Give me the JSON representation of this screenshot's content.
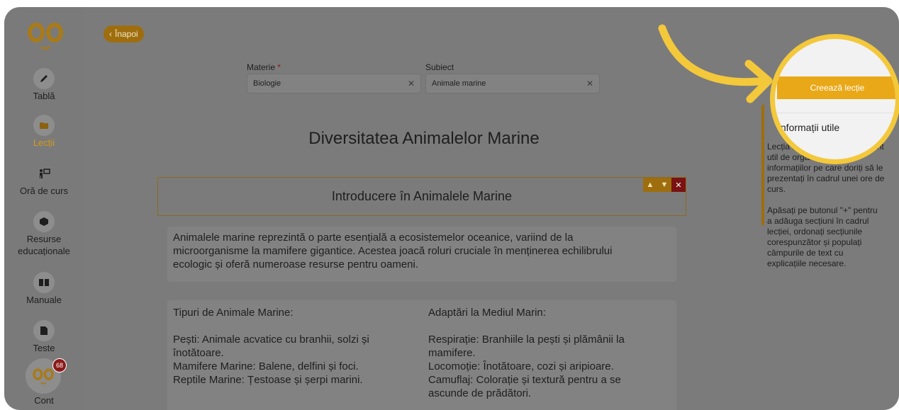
{
  "sidebar": {
    "items": [
      {
        "label": "Tablă",
        "icon": "pencil-icon"
      },
      {
        "label": "Lecții",
        "icon": "folder-icon"
      },
      {
        "label": "Oră de curs",
        "icon": "teacher-board-icon"
      },
      {
        "label": "Resurse",
        "label2": "educaționale",
        "icon": "cube-icon"
      },
      {
        "label": "Manuale",
        "icon": "book-icon"
      },
      {
        "label": "Teste",
        "icon": "document-icon"
      },
      {
        "label": "Cont",
        "icon": "avatar-icon"
      }
    ],
    "notification_count": "68"
  },
  "header": {
    "back_label": "Înapoi"
  },
  "form": {
    "materie_label": "Materie",
    "materie_required": "*",
    "materie_value": "Biologie",
    "subiect_label": "Subiect",
    "subiect_value": "Animale marine"
  },
  "lesson": {
    "title": "Diversitatea Animalelor Marine",
    "section_title": "Introducere în Animalele Marine",
    "intro_lines": [
      "Animalele marine reprezintă o parte esențială a ecosistemelor oceanice, variind de la",
      "microorganisme la mamifere gigantice. Acestea joacă roluri cruciale în menținerea echilibrului",
      "ecologic și oferă numeroase resurse pentru oameni."
    ],
    "left_col": {
      "heading": "Tipuri de Animale Marine:",
      "lines": [
        "Pești: Animale acvatice cu branhii, solzi și",
        "înotătoare.",
        "Mamifere Marine: Balene, delfini și foci.",
        "Reptile Marine: Țestoase și șerpi marini."
      ]
    },
    "right_col": {
      "heading": "Adaptări la Mediul Marin:",
      "lines": [
        "Respirație: Branhiile la pești și plămânii la",
        "mamifere.",
        "Locomoție: Înotătoare, cozi și aripioare.",
        "Camuflaj: Colorație și textură pentru a se",
        "ascunde de prădători."
      ]
    }
  },
  "right_panel": {
    "create_button": "Creează lecție",
    "info_title": "Informații utile",
    "info_p1_lines": [
      "Lecția reprezintă un instrument",
      "util de organizare a",
      "informațiilor pe care doriți să le",
      "prezentați în cadrul unei ore de",
      "curs."
    ],
    "info_p2_lines": [
      "Apăsați pe butonul \"+\" pentru",
      "a adăuga secțiuni în cadrul",
      "lecției, ordonați secțiunile",
      "corespunzător și populați",
      "câmpurile de text cu",
      "explicațiile necesare."
    ]
  },
  "colors": {
    "accent": "#e9a818",
    "highlight_ring": "#f3c83b",
    "danger": "#7a1212"
  }
}
